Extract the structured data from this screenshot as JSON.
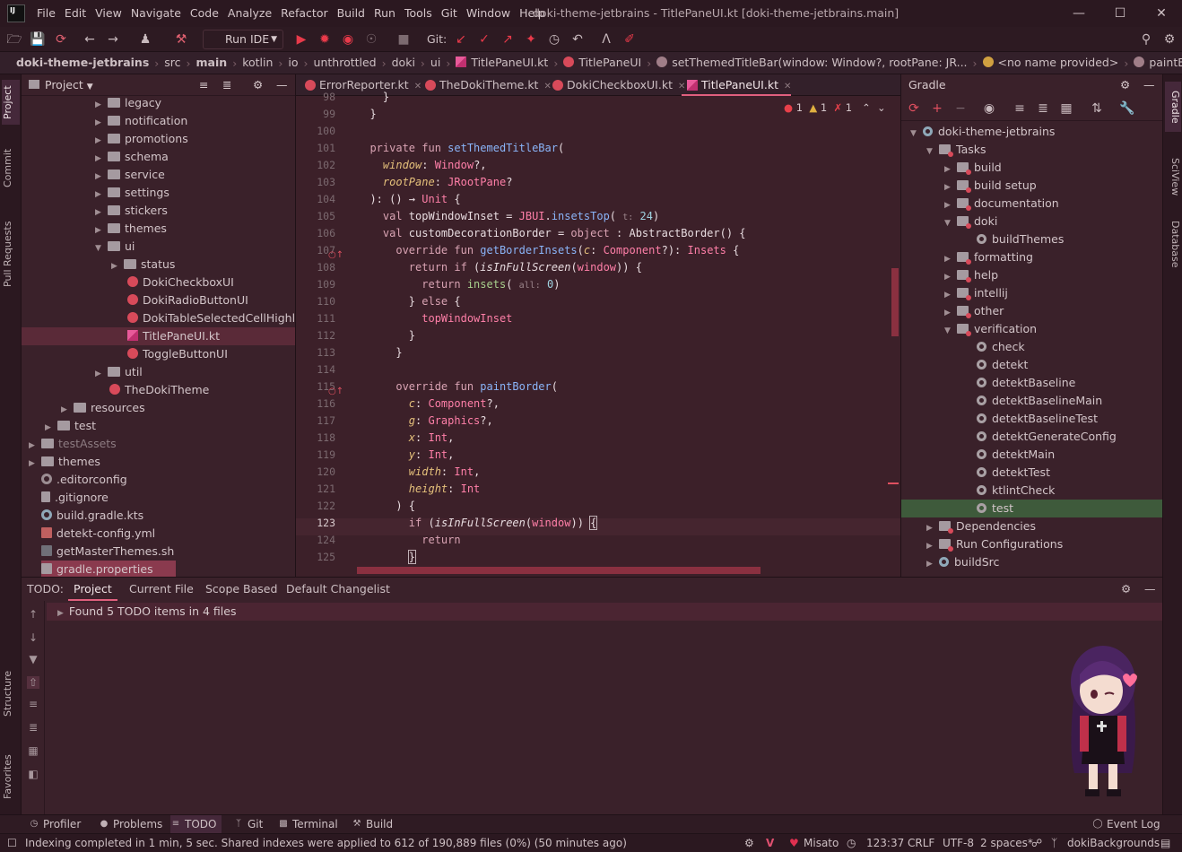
{
  "menubar": {
    "logo_text": "IJ",
    "items": [
      "File",
      "Edit",
      "View",
      "Navigate",
      "Code",
      "Analyze",
      "Refactor",
      "Build",
      "Run",
      "Tools",
      "Git",
      "Window",
      "Help"
    ],
    "title": "doki-theme-jetbrains - TitlePaneUI.kt [doki-theme-jetbrains.main]"
  },
  "toolbar": {
    "run_config": "Run IDE",
    "git_label": "Git:"
  },
  "breadcrumb": [
    "doki-theme-jetbrains",
    "src",
    "main",
    "kotlin",
    "io",
    "unthrottled",
    "doki",
    "ui",
    "TitlePaneUI.kt",
    "TitlePaneUI",
    "setThemedTitleBar(window: Window?, rootPane: JR...",
    "<no name provided>",
    "paintBorder(c: Component?, g: Graphics"
  ],
  "left_stripe": {
    "project": "Project",
    "commit": "Commit",
    "pull_requests": "Pull Requests",
    "structure": "Structure",
    "favorites": "Favorites"
  },
  "right_stripe": {
    "gradle": "Gradle",
    "sciview": "SciView",
    "database": "Database"
  },
  "project": {
    "title": "Project",
    "items": [
      {
        "label": "legacy"
      },
      {
        "label": "notification"
      },
      {
        "label": "promotions"
      },
      {
        "label": "schema"
      },
      {
        "label": "service"
      },
      {
        "label": "settings"
      },
      {
        "label": "stickers"
      },
      {
        "label": "themes"
      },
      {
        "label": "ui"
      },
      {
        "label": "status"
      },
      {
        "label": "DokiCheckboxUI"
      },
      {
        "label": "DokiRadioButtonUI"
      },
      {
        "label": "DokiTableSelectedCellHighlightBorder"
      },
      {
        "label": "TitlePaneUI.kt"
      },
      {
        "label": "ToggleButtonUI"
      },
      {
        "label": "util"
      },
      {
        "label": "TheDokiTheme"
      },
      {
        "label": "resources"
      },
      {
        "label": "test"
      },
      {
        "label": "testAssets"
      },
      {
        "label": "themes"
      },
      {
        "label": ".editorconfig"
      },
      {
        "label": ".gitignore"
      },
      {
        "label": "build.gradle.kts"
      },
      {
        "label": "detekt-config.yml"
      },
      {
        "label": "getMasterThemes.sh"
      },
      {
        "label": "gradle.properties"
      }
    ]
  },
  "editor": {
    "tabs": [
      "ErrorReporter.kt",
      "TheDokiTheme.kt",
      "DokiCheckboxUI.kt",
      "TitlePaneUI.kt"
    ],
    "indicators": {
      "errors": "1",
      "warnings": "1",
      "weak": "1"
    },
    "line_numbers": [
      "98",
      "99",
      "100",
      "101",
      "102",
      "103",
      "104",
      "105",
      "106",
      "107",
      "108",
      "109",
      "110",
      "111",
      "112",
      "113",
      "114",
      "115",
      "116",
      "117",
      "118",
      "119",
      "120",
      "121",
      "122",
      "123",
      "124",
      "125"
    ],
    "hint_t": "t:",
    "hint_all": "all:"
  },
  "gradle": {
    "title": "Gradle",
    "items": [
      "doki-theme-jetbrains",
      "Tasks",
      "build",
      "build setup",
      "documentation",
      "doki",
      "buildThemes",
      "formatting",
      "help",
      "intellij",
      "other",
      "verification",
      "check",
      "detekt",
      "detektBaseline",
      "detektBaselineMain",
      "detektBaselineTest",
      "detektGenerateConfig",
      "detektMain",
      "detektTest",
      "ktlintCheck",
      "test",
      "Dependencies",
      "Run Configurations",
      "buildSrc"
    ]
  },
  "todo": {
    "label": "TODO:",
    "tabs": [
      "Project",
      "Current File",
      "Scope Based",
      "Default Changelist"
    ],
    "result": "Found 5 TODO items in 4 files"
  },
  "bottom_tabs": [
    "Profiler",
    "Problems",
    "TODO",
    "Git",
    "Terminal",
    "Build"
  ],
  "event_log": "Event Log",
  "status": {
    "message": "Indexing completed in 1 min, 5 sec. Shared indexes were applied to 612 of 190,889 files (0%) (50 minutes ago)",
    "character": "Misato",
    "position": "123:37",
    "line_sep": "CRLF",
    "encoding": "UTF-8",
    "indent": "2 spaces*",
    "branch": "dokiBackgrounds"
  },
  "colors": {
    "accent": "#e0607e",
    "background": "#3c2029",
    "keyword": "#d9a3b3",
    "function": "#8ab4f8",
    "type": "#ff7fa8"
  }
}
